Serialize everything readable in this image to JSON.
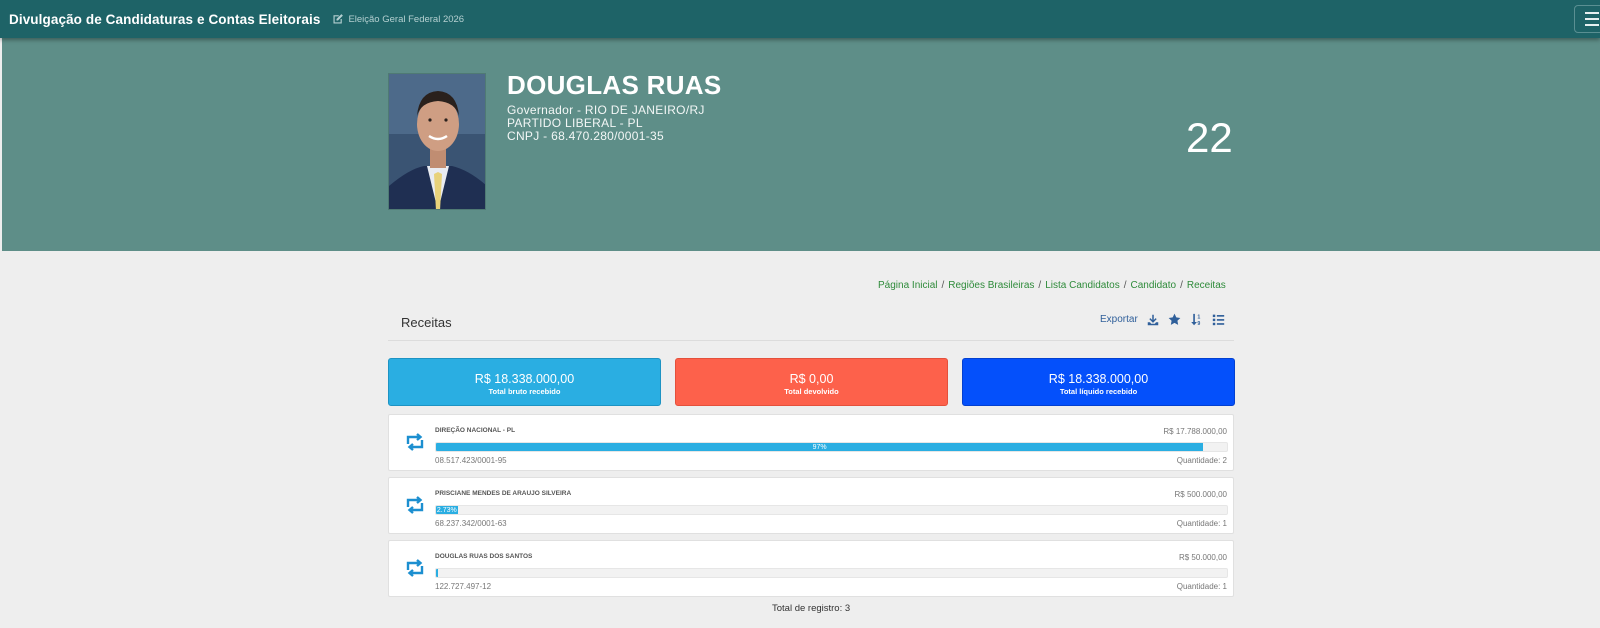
{
  "header": {
    "brand": "Divulgação de Candidaturas e Contas Eleitorais",
    "election": "Eleição Geral Federal 2026"
  },
  "candidate": {
    "name": "DOUGLAS RUAS",
    "office": "Governador - RIO DE JANEIRO/RJ",
    "party": "PARTIDO LIBERAL - PL",
    "cnpj": "CNPJ - 68.470.280/0001-35",
    "number": "22"
  },
  "breadcrumb": [
    "Página Inicial",
    "Regiões Brasileiras",
    "Lista Candidatos",
    "Candidato",
    "Receitas"
  ],
  "section": {
    "title": "Receitas",
    "export_label": "Exportar"
  },
  "summary": [
    {
      "value": "R$ 18.338.000,00",
      "label": "Total bruto recebido",
      "color": "#2aaee2"
    },
    {
      "value": "R$ 0,00",
      "label": "Total devolvido",
      "color": "#fd614b"
    },
    {
      "value": "R$ 18.338.000,00",
      "label": "Total líquido recebido",
      "color": "#0450fb"
    }
  ],
  "receipts": [
    {
      "name": "DIREÇÃO NACIONAL - PL",
      "value": "R$ 17.788.000,00",
      "percent_label": "97%",
      "percent": 97,
      "doc": "08.517.423/0001-95",
      "quantity": "Quantidade: 2"
    },
    {
      "name": "PRISCIANE MENDES DE ARAUJO SILVEIRA",
      "value": "R$ 500.000,00",
      "percent_label": "2.73%",
      "percent": 2.73,
      "doc": "68.237.342/0001-63",
      "quantity": "Quantidade: 1"
    },
    {
      "name": "DOUGLAS RUAS DOS SANTOS",
      "value": "R$ 50.000,00",
      "percent_label": "",
      "percent": 0.27,
      "doc": "122.727.497-12",
      "quantity": "Quantidade: 1"
    }
  ],
  "total": "Total de registro: 3",
  "colors": {
    "navbar": "#1e6367",
    "hero": "#5e8e88",
    "accent": "#2aaee2",
    "link": "#2e8b3a"
  }
}
